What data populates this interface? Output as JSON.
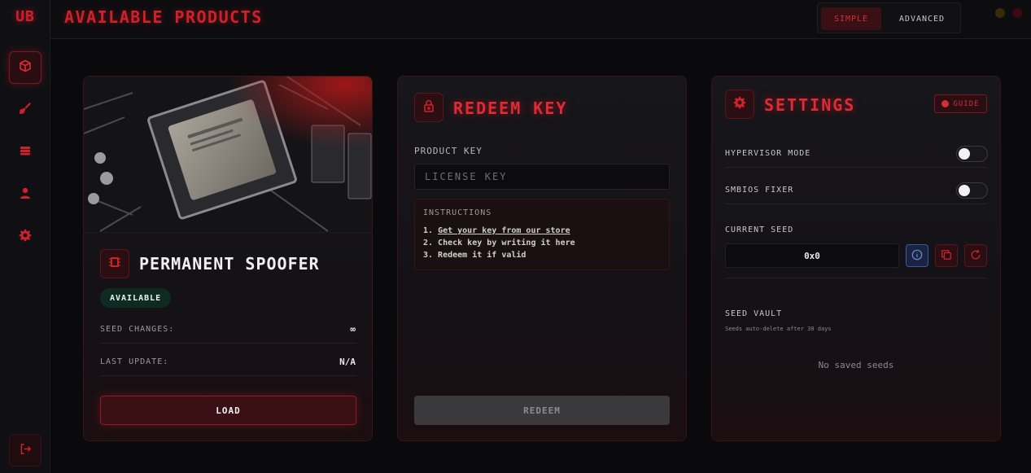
{
  "app": {
    "logo": "UB"
  },
  "header": {
    "title": "AVAILABLE PRODUCTS"
  },
  "mode": {
    "simple_label": "SIMPLE",
    "advanced_label": "ADVANCED",
    "selected": "SIMPLE"
  },
  "sidebar": {
    "items": [
      {
        "icon": "cube-icon",
        "active": true
      },
      {
        "icon": "broom-icon",
        "active": false
      },
      {
        "icon": "memory-icon",
        "active": false
      },
      {
        "icon": "user-icon",
        "active": false
      },
      {
        "icon": "gear-icon",
        "active": false
      }
    ],
    "logout_icon": "logout-icon"
  },
  "product": {
    "name": "PERMANENT SPOOFER",
    "status": "AVAILABLE",
    "seed_changes_label": "SEED CHANGES:",
    "seed_changes_value": "∞",
    "last_update_label": "LAST UPDATE:",
    "last_update_value": "N/A",
    "load_label": "LOAD",
    "image_subject": "CPU in motherboard socket"
  },
  "redeem": {
    "title": "REDEEM KEY",
    "field_label": "PRODUCT KEY",
    "placeholder": "LICENSE KEY",
    "value": "",
    "instructions_title": "INSTRUCTIONS",
    "step1_prefix": "1. ",
    "step1_link": "Get your key from our store",
    "step2": "2. Check key by writing it here",
    "step3": "3. Redeem it if valid",
    "button_label": "REDEEM"
  },
  "settings": {
    "title": "SETTINGS",
    "guide_label": "GUIDE",
    "hypervisor_label": "HYPERVISOR MODE",
    "hypervisor_on": false,
    "smbios_label": "SMBIOS FIXER",
    "smbios_on": false,
    "current_seed_label": "CURRENT SEED",
    "current_seed_value": "0x0",
    "vault_title": "SEED VAULT",
    "vault_subtitle": "Seeds auto-delete after 30 days",
    "vault_empty": "No saved seeds"
  },
  "colors": {
    "accent": "#d0202a",
    "badge_green": "#0f2a20",
    "info_blue": "#3a5aa0"
  }
}
